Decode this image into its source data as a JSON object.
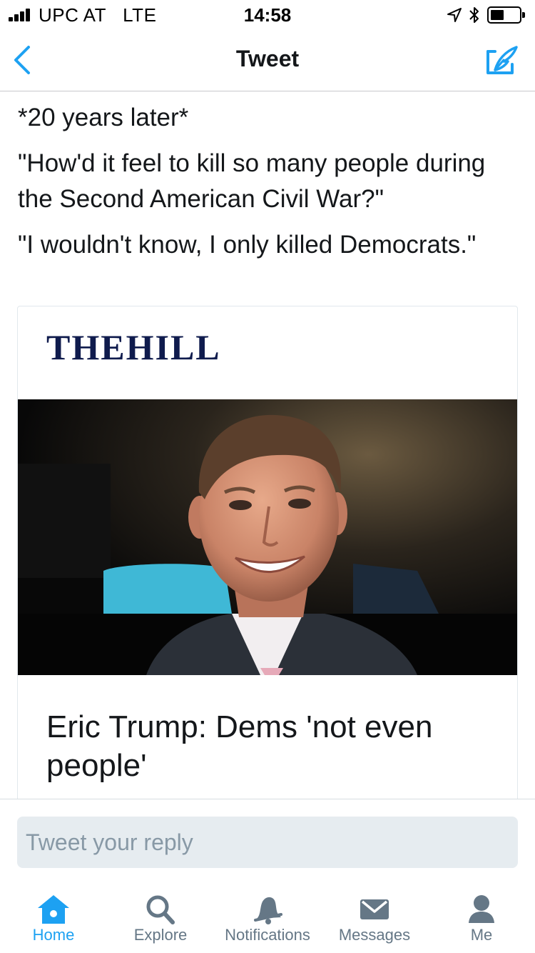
{
  "status_bar": {
    "carrier": "UPC AT",
    "network": "LTE",
    "time": "14:58"
  },
  "nav": {
    "title": "Tweet",
    "back_icon": "chevron-left-icon",
    "compose_icon": "compose-tweet-icon"
  },
  "tweet": {
    "lines": [
      "*20 years later*",
      "\"How'd it feel to kill so many people during the Second American Civil War?\"",
      "\"I wouldn't know, I only killed Democrats.\""
    ]
  },
  "card": {
    "logo_text": "THEHILL",
    "image_description": "photo-of-man-in-suit-smiling",
    "title": "Eric Trump: Dems 'not even people'"
  },
  "reply": {
    "placeholder": "Tweet your reply"
  },
  "tab_bar": {
    "tabs": [
      {
        "label": "Home",
        "icon": "home-icon",
        "active": true
      },
      {
        "label": "Explore",
        "icon": "search-icon",
        "active": false
      },
      {
        "label": "Notifications",
        "icon": "bell-icon",
        "active": false
      },
      {
        "label": "Messages",
        "icon": "envelope-icon",
        "active": false
      },
      {
        "label": "Me",
        "icon": "person-icon",
        "active": false
      }
    ]
  },
  "colors": {
    "accent": "#1da1f2",
    "tab_inactive": "#657786",
    "text": "#14171a",
    "placeholder": "#8899a6",
    "input_bg": "#e6ecf0"
  }
}
